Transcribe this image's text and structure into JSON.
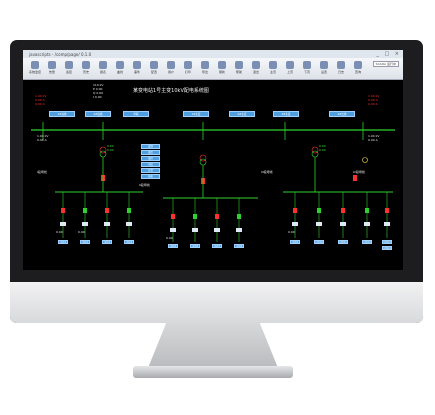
{
  "window": {
    "title": "javascripts - /comp/page/ 0.1.0",
    "controls": "_ □ ×"
  },
  "toolbar": {
    "items": [
      "系统监控",
      "告警",
      "遥控",
      "历史",
      "报表",
      "曲线",
      "事件",
      "配置",
      "用户",
      "打印",
      "导出",
      "刷新",
      "帮助",
      "退出",
      "主页",
      "上页",
      "下页",
      "设置",
      "日志",
      "查询",
      "统计",
      "维护",
      "关于"
    ],
    "status": "SCADA 运行中"
  },
  "diagram": {
    "title": "某变电站1号主变10kV配电系统图",
    "top_readings": [
      "110 kV",
      "P 0.00",
      "Q 0.00",
      "I 0.00"
    ],
    "left_readings": {
      "a": [
        "1.04 kV",
        "0.00 A",
        "0.00 A"
      ],
      "b": [
        "1.04 kV",
        "0.00 A"
      ],
      "c": [
        "0.00",
        "0.00"
      ]
    },
    "right_readings": {
      "a": [
        "1.04 kV",
        "0.00 A",
        "0.00 A"
      ],
      "b": [
        "1.04 kV",
        "0.00 A"
      ],
      "c": [
        "0.00",
        "0.00"
      ]
    },
    "header_buttons": [
      "1#进线",
      "2#进线",
      "母联",
      "1#主变",
      "2#主变",
      "3#主变",
      "4#出线"
    ],
    "side_buttons": [
      "遥测",
      "遥信",
      "遥控",
      "电度",
      "告警",
      "报表"
    ],
    "bus_labels": [
      "I段母线",
      "II段母线",
      "III段母线",
      "IV段母线"
    ],
    "feeder_values": [
      "0.00",
      "0.00"
    ],
    "feeder_buttons": [
      "出线1",
      "出线2",
      "出线3",
      "出线4",
      "出线5",
      "出线6",
      "出线7",
      "出线8",
      "出线9",
      "出线10",
      "出线11",
      "出线12",
      "出线13",
      "出线14"
    ]
  }
}
